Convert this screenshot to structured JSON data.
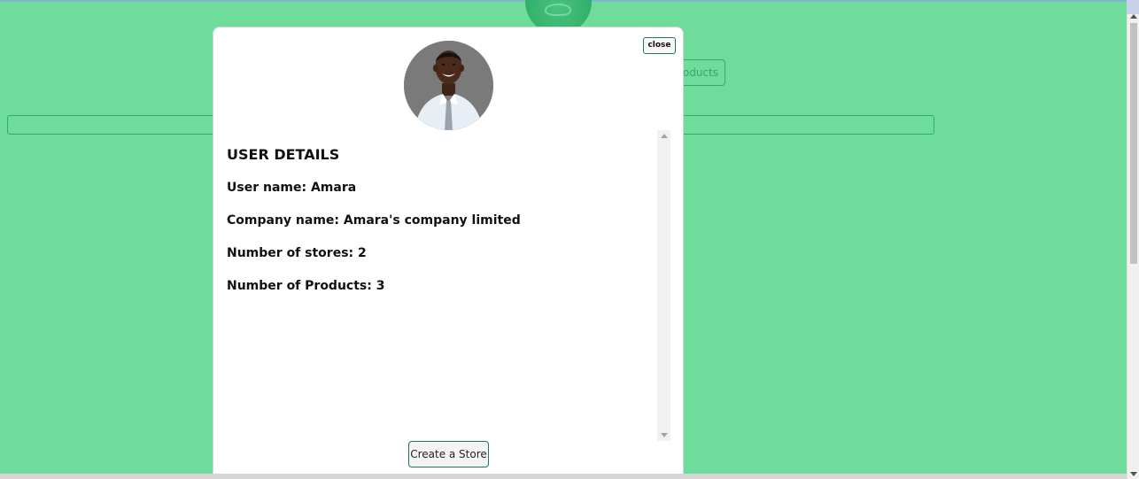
{
  "background_page": {
    "products_button_label": "Products"
  },
  "modal": {
    "close_label": "close",
    "title": "USER DETAILS",
    "rows": [
      {
        "label": "User name:",
        "value": "Amara"
      },
      {
        "label": "Company name:",
        "value": "Amara's company limited"
      },
      {
        "label": "Number of stores:",
        "value": "2"
      },
      {
        "label": "Number of Products:",
        "value": "3"
      }
    ],
    "create_store_label": "Create a Store"
  },
  "colors": {
    "page_background": "#6fdc9b",
    "accent_green": "#1f7a52",
    "modal_background": "#ffffff"
  },
  "icons": {
    "avatar": "user-photo",
    "logo": "leaf-logo"
  }
}
